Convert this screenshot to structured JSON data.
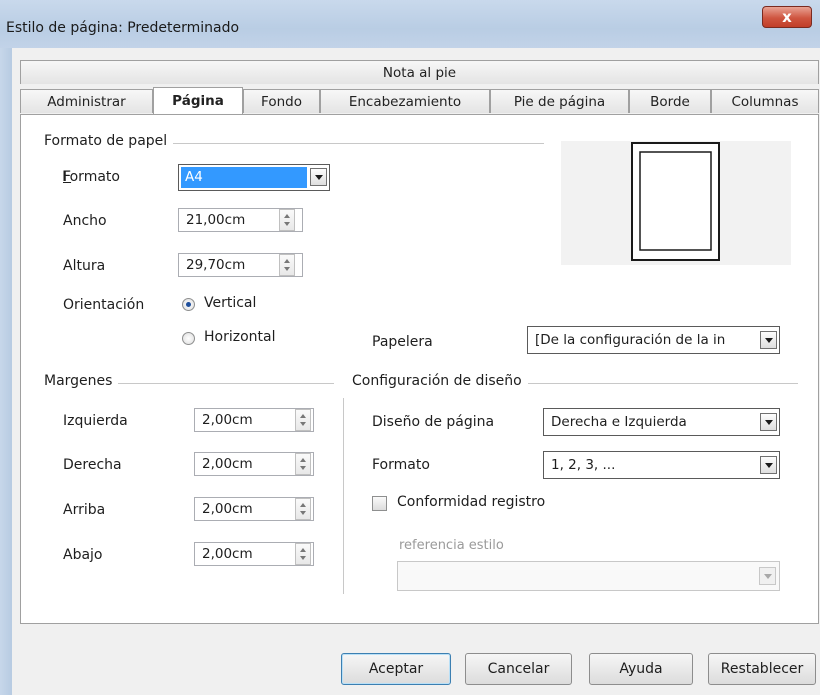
{
  "window": {
    "title": "Estilo de página: Predeterminado",
    "close_label": "x"
  },
  "tabs": {
    "top_row": [
      "Nota al pie"
    ],
    "bottom_row": [
      "Administrar",
      "Página",
      "Fondo",
      "Encabezamiento",
      "Pie de página",
      "Borde",
      "Columnas"
    ],
    "active": "Página"
  },
  "paper_format": {
    "section_title": "Formato de papel",
    "format": {
      "label": "Formato",
      "value": "A4"
    },
    "width": {
      "label": "Ancho",
      "value": "21,00cm"
    },
    "height": {
      "label": "Altura",
      "value": "29,70cm"
    },
    "orientation": {
      "label": "Orientación",
      "options": [
        "Vertical",
        "Horizontal"
      ],
      "selected": "Vertical"
    },
    "paper_tray": {
      "label": "Papelera",
      "value": "[De la configuración de la in"
    }
  },
  "margins": {
    "section_title": "Margenes",
    "left": {
      "label": "Izquierda",
      "value": "2,00cm"
    },
    "right": {
      "label": "Derecha",
      "value": "2,00cm"
    },
    "top": {
      "label": "Arriba",
      "value": "2,00cm"
    },
    "bottom": {
      "label": "Abajo",
      "value": "2,00cm"
    }
  },
  "layout": {
    "section_title": "Configuración de diseño",
    "page_layout": {
      "label": "Diseño de página",
      "value": "Derecha e Izquierda"
    },
    "format": {
      "label": "Formato",
      "value": "1, 2, 3, ..."
    },
    "register_true": {
      "label": "Conformidad registro",
      "checked": false
    },
    "reference_style": {
      "label": "referencia estilo",
      "value": ""
    }
  },
  "buttons": {
    "ok": "Aceptar",
    "cancel": "Cancelar",
    "help": "Ayuda",
    "reset": "Restablecer"
  },
  "colors": {
    "selection": "#3399ff",
    "titlebar": "#c2d3e8",
    "close": "#c13e29"
  }
}
